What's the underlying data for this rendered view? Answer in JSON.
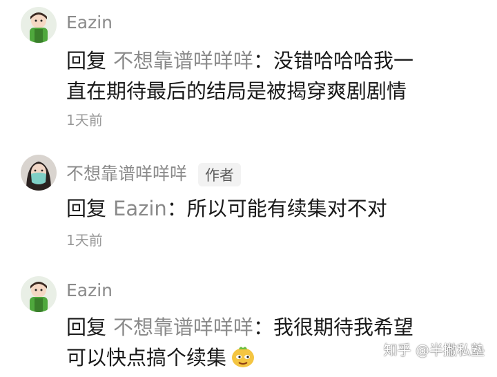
{
  "comments": [
    {
      "author": "Eazin",
      "reply_prefix": "回复",
      "reply_to": "不想靠谱咩咩咩",
      "colon": "：",
      "line1": "没错哈哈哈我一",
      "line2": "直在期待最后的结局是被揭穿爽剧剧情",
      "time": "1天前"
    },
    {
      "author": "不想靠谱咩咩咩",
      "badge": "作者",
      "reply_prefix": "回复",
      "reply_to": "Eazin",
      "colon": "：",
      "line1": "所以可能有续集对不对",
      "time": "1天前"
    },
    {
      "author": "Eazin",
      "reply_prefix": "回复",
      "reply_to": "不想靠谱咩咩咩",
      "colon": "：",
      "line1": "我很期待我希望",
      "line2": "可以快点搞个续集",
      "sticker": "smug-face-sticker"
    }
  ],
  "watermark": "知乎 @半撇私塾",
  "colors": {
    "name_gray": "#8a8a8a",
    "text_dark": "#1a1a1a",
    "time_gray": "#9a9a9a",
    "badge_bg": "#f2f2f2"
  }
}
